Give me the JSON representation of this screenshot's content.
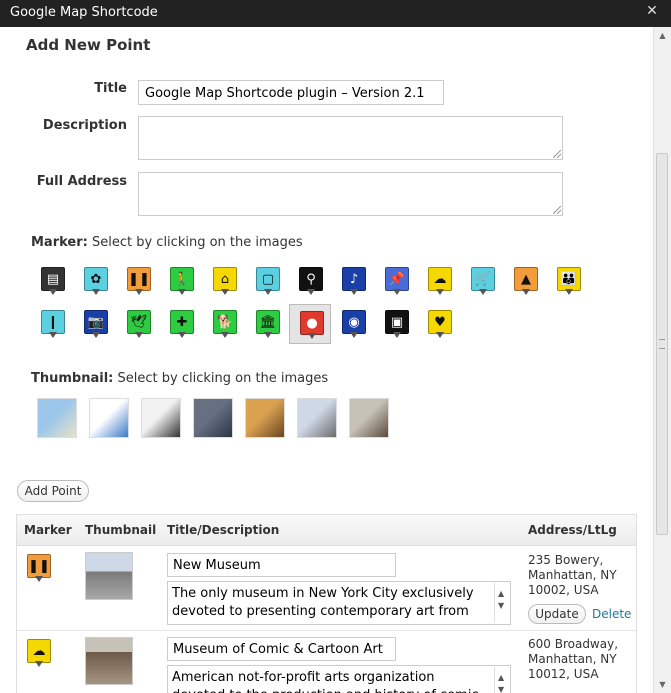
{
  "window": {
    "title": "Google Map Shortcode",
    "close_icon": "close-icon"
  },
  "form": {
    "heading": "Add New Point",
    "title_label": "Title",
    "title_value": "Google Map Shortcode plugin – Version 2.1",
    "description_label": "Description",
    "description_value": "",
    "address_label": "Full Address",
    "address_value": ""
  },
  "marker_section": {
    "label_bold": "Marker:",
    "label_text": "Select by clicking on the images"
  },
  "markers": [
    {
      "name": "book-marker",
      "glyph": "▤",
      "color": "#333333"
    },
    {
      "name": "flower-marker",
      "glyph": "✿",
      "color": "#5bd0e0"
    },
    {
      "name": "library-marker",
      "glyph": "❚❚",
      "color": "#f39c3b"
    },
    {
      "name": "walking-marker",
      "glyph": "🚶",
      "color": "#2ecc40"
    },
    {
      "name": "home-marker",
      "glyph": "⌂",
      "color": "#f5d800"
    },
    {
      "name": "laundry-marker",
      "glyph": "▢",
      "color": "#5bd0e0"
    },
    {
      "name": "bicycle-marker",
      "glyph": "⚲",
      "color": "#111111"
    },
    {
      "name": "speaker-marker",
      "glyph": "♪",
      "color": "#1a3fa8"
    },
    {
      "name": "pushpin-marker",
      "glyph": "📌",
      "color": "#4b6bd8"
    },
    {
      "name": "chat-marker",
      "glyph": "☁",
      "color": "#f5d800"
    },
    {
      "name": "cart-marker",
      "glyph": "🛒",
      "color": "#5bd0e0"
    },
    {
      "name": "school-marker",
      "glyph": "▲",
      "color": "#f39c3b"
    },
    {
      "name": "family-marker",
      "glyph": "👪",
      "color": "#f5d800"
    },
    {
      "name": "bookmark-marker",
      "glyph": "❙",
      "color": "#5bd0e0"
    },
    {
      "name": "camera-marker",
      "glyph": "📷",
      "color": "#1a3fa8"
    },
    {
      "name": "bird-marker",
      "glyph": "🕊",
      "color": "#2ecc40"
    },
    {
      "name": "hospital-marker",
      "glyph": "✚",
      "color": "#2ecc40"
    },
    {
      "name": "dog-marker",
      "glyph": "🐕",
      "color": "#2ecc40"
    },
    {
      "name": "museum-marker",
      "glyph": "🏛",
      "color": "#2ecc40"
    },
    {
      "name": "pin-marker",
      "glyph": "●",
      "color": "#e03a2e"
    },
    {
      "name": "search-marker",
      "glyph": "◉",
      "color": "#1a3fa8"
    },
    {
      "name": "bus-marker",
      "glyph": "▣",
      "color": "#111111"
    },
    {
      "name": "hearts-marker",
      "glyph": "♥",
      "color": "#f5d800"
    }
  ],
  "thumbnail_section": {
    "label_bold": "Thumbnail:",
    "label_text": "Select by clicking on the images"
  },
  "thumbnails": [
    {
      "name": "map-thumbnail",
      "colors": [
        "#9cc7ea",
        "#e7e2c6"
      ]
    },
    {
      "name": "icons-thumbnail",
      "colors": [
        "#ffffff",
        "#3a79c8"
      ]
    },
    {
      "name": "webpage-thumbnail",
      "colors": [
        "#f2f2f2",
        "#333333"
      ]
    },
    {
      "name": "building-thumbnail",
      "colors": [
        "#667080",
        "#2b3544"
      ]
    },
    {
      "name": "interior-thumbnail",
      "colors": [
        "#d9a050",
        "#6a4520"
      ]
    },
    {
      "name": "new-museum-thumbnail",
      "colors": [
        "#cfd8e6",
        "#6c6c6c"
      ]
    },
    {
      "name": "comic-museum-thumbnail",
      "colors": [
        "#c7c2b8",
        "#5a4a3a"
      ]
    }
  ],
  "add_point_label": "Add Point",
  "table": {
    "headers": {
      "marker": "Marker",
      "thumbnail": "Thumbnail",
      "title": "Title/Description",
      "address": "Address/LtLg"
    },
    "rows": [
      {
        "title": "New Museum",
        "description": "The only museum in New York City exclusively devoted to presenting contemporary art from",
        "address": [
          "235 Bowery,",
          "Manhattan, NY",
          "10002, USA"
        ],
        "update_label": "Update",
        "delete_label": "Delete",
        "marker_color": "#f39c3b",
        "marker_glyph": "❚❚"
      },
      {
        "title": "Museum of Comic & Cartoon Art",
        "description": "American not-for-profit arts organization devoted to the production and history of comic",
        "address": [
          "600 Broadway,",
          "Manhattan, NY",
          "10012, USA"
        ],
        "marker_color": "#f5d800",
        "marker_glyph": "☁"
      }
    ]
  }
}
